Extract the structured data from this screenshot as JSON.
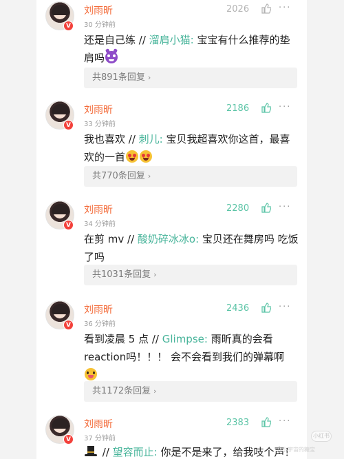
{
  "colors": {
    "username": "#f36a38",
    "author": "#47b49a",
    "badge": "#f3413b",
    "likes_hot": "#5bc4a6"
  },
  "comments": [
    {
      "user": "刘雨昕",
      "badge": "V",
      "time": "30 分钟前",
      "likes": "2026",
      "more": "···",
      "text": "还是自己练 // ",
      "reply_author": "溜肩小猫:",
      "reply_text": " 宝宝有什么推荐的垫肩吗",
      "emojis": [
        "smiling-devil"
      ],
      "reply_count": "共891条回复"
    },
    {
      "user": "刘雨昕",
      "badge": "V",
      "time": "33 分钟前",
      "likes": "2186",
      "more": "···",
      "text": "我也喜欢 // ",
      "reply_author": "刺儿:",
      "reply_text": " 宝贝我超喜欢你这首，最喜欢的一首",
      "emojis": [
        "heart-eyes",
        "heart-eyes"
      ],
      "reply_count": "共770条回复"
    },
    {
      "user": "刘雨昕",
      "badge": "V",
      "time": "34 分钟前",
      "likes": "2280",
      "more": "···",
      "text": "在剪 mv // ",
      "reply_author": "酸奶碎冰冰o:",
      "reply_text": " 宝贝还在舞房吗 吃饭了吗",
      "emojis": [],
      "reply_count": "共1031条回复"
    },
    {
      "user": "刘雨昕",
      "badge": "V",
      "time": "36 分钟前",
      "likes": "2436",
      "more": "···",
      "text": "看到凌晨 5 点 // ",
      "reply_author": "Glimpse:",
      "reply_text": " 雨昕真的会看reaction吗！！！ 会不会看到我们的弹幕啊",
      "emojis": [
        "winking-tongue"
      ],
      "reply_count": "共1172条回复"
    },
    {
      "user": "刘雨昕",
      "badge": "V",
      "time": "37 分钟前",
      "likes": "2383",
      "more": "···",
      "text": " // ",
      "reply_author": "望容而止:",
      "reply_text": " 你是不是来了，给我吱个声！",
      "emojis": [
        "top-hat"
      ],
      "reply_count": ""
    }
  ],
  "reply_chevron": "›",
  "watermark": {
    "icon_label": "小红书",
    "text": "@小宇宙的糖宝"
  }
}
